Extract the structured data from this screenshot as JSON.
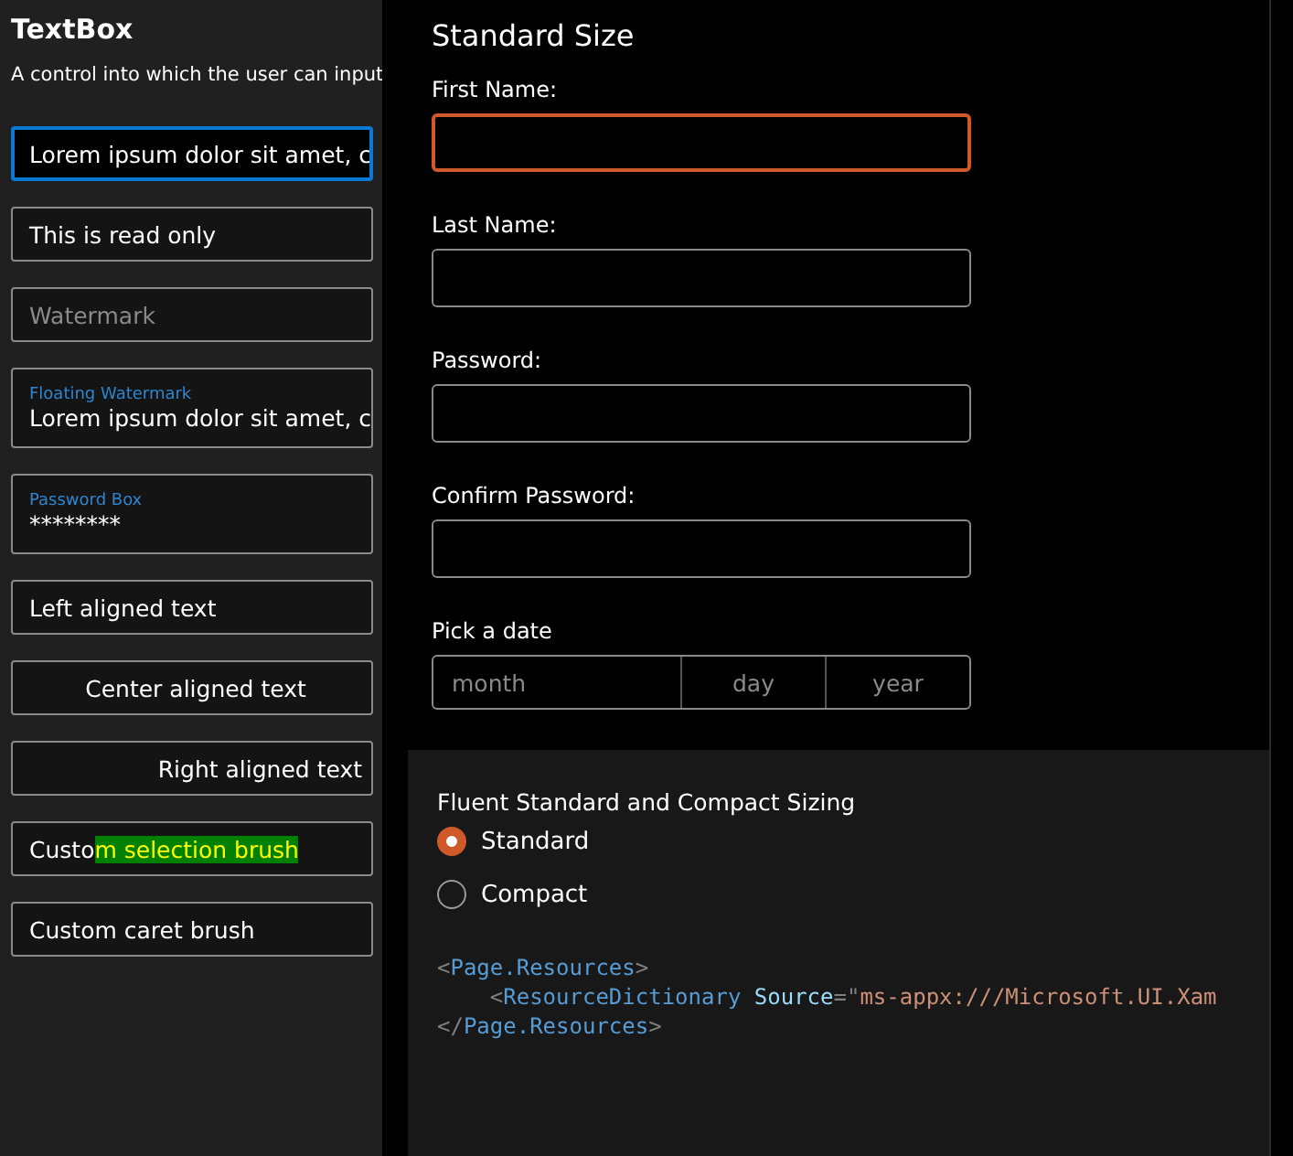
{
  "sidebar": {
    "title": "TextBox",
    "description": "A control into which the user can input",
    "textboxes": [
      {
        "kind": "text",
        "text": "Lorem ipsum dolor sit amet, c",
        "focused": true
      },
      {
        "kind": "text",
        "text": "This is read only",
        "focused": false
      },
      {
        "kind": "placeholder",
        "placeholder": "Watermark",
        "focused": false
      },
      {
        "kind": "floating",
        "header": "Floating Watermark",
        "text": "Lorem ipsum dolor sit amet, c",
        "focused": false
      },
      {
        "kind": "floating",
        "header": "Password Box",
        "text": "********",
        "focused": false
      },
      {
        "kind": "text",
        "text": "Left aligned text",
        "focused": false
      },
      {
        "kind": "centered",
        "text": "Center aligned text",
        "focused": false
      },
      {
        "kind": "right_aligned",
        "text": "Right aligned text",
        "focused": false
      },
      {
        "kind": "selection",
        "parts": [
          {
            "text": "Custo",
            "selected": false
          },
          {
            "text": "m selection brush",
            "selected": true
          }
        ],
        "focused": false
      },
      {
        "kind": "text",
        "text": "Custom caret brush",
        "focused": false
      }
    ]
  },
  "form": {
    "title": "Standard Size",
    "fields": [
      {
        "label": "First Name:",
        "focused": true
      },
      {
        "label": "Last Name:",
        "focused": false
      },
      {
        "label": "Password:",
        "focused": false
      },
      {
        "label": "Confirm Password:",
        "focused": false
      }
    ],
    "date_picker": {
      "label": "Pick a date",
      "parts": [
        "month",
        "day",
        "year"
      ]
    }
  },
  "sizing": {
    "title": "Fluent Standard and Compact Sizing",
    "options": [
      {
        "label": "Standard",
        "selected": true
      },
      {
        "label": "Compact",
        "selected": false
      }
    ]
  },
  "code": [
    [
      {
        "kind": "punct",
        "text": "<"
      },
      {
        "kind": "tag",
        "text": "Page.Resources"
      },
      {
        "kind": "punct",
        "text": ">"
      }
    ],
    [
      {
        "kind": "punct",
        "text": "    <"
      },
      {
        "kind": "tag",
        "text": "ResourceDictionary"
      },
      {
        "kind": "attr",
        "text": " Source"
      },
      {
        "kind": "punct",
        "text": "=\""
      },
      {
        "kind": "string",
        "text": "ms-appx:///Microsoft.UI.Xam"
      }
    ],
    [
      {
        "kind": "punct",
        "text": "</"
      },
      {
        "kind": "tag",
        "text": "Page.Resources"
      },
      {
        "kind": "punct",
        "text": ">"
      }
    ]
  ]
}
